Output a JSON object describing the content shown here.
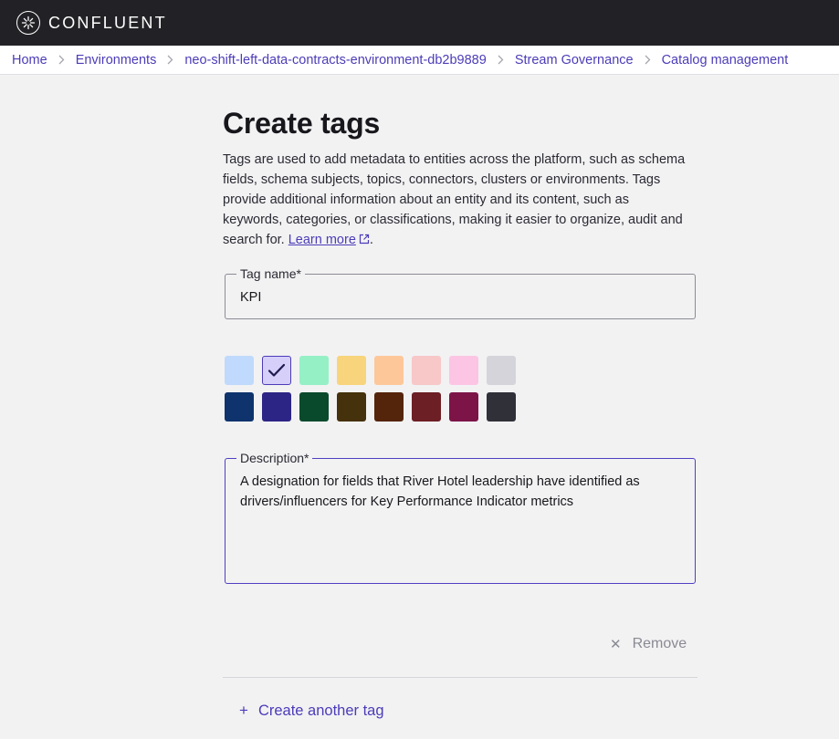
{
  "brand": {
    "name": "CONFLUENT"
  },
  "breadcrumb": [
    {
      "label": "Home"
    },
    {
      "label": "Environments"
    },
    {
      "label": "neo-shift-left-data-contracts-environment-db2b9889"
    },
    {
      "label": "Stream Governance"
    },
    {
      "label": "Catalog management"
    }
  ],
  "page": {
    "title": "Create tags",
    "intro": "Tags are used to add metadata to entities across the platform, such as schema fields, schema subjects, topics, connectors, clusters or environments. Tags provide additional information about an entity and its content, such as keywords, categories, or classifications, making it easier to organize, audit and search for.",
    "learn_more": "Learn more",
    "intro_end": "."
  },
  "form": {
    "tag_name": {
      "label": "Tag name*",
      "value": "KPI"
    },
    "description": {
      "label": "Description*",
      "value": "A designation for fields that River Hotel leadership have identified as drivers/influencers for Key Performance Indicator metrics"
    },
    "colors": {
      "light": [
        "#bfdafc",
        "#d5cffa",
        "#95f0c6",
        "#f8d47c",
        "#fdc79a",
        "#f8c7c8",
        "#fcc5e4",
        "#d4d4da"
      ],
      "dark": [
        "#0f346d",
        "#2d2585",
        "#0a4a2c",
        "#45310c",
        "#54250b",
        "#6c1f24",
        "#7d1448",
        "#303038"
      ],
      "selected_row": "light",
      "selected_index": 1
    }
  },
  "actions": {
    "remove_label": "Remove",
    "create_another_label": "Create another tag"
  }
}
